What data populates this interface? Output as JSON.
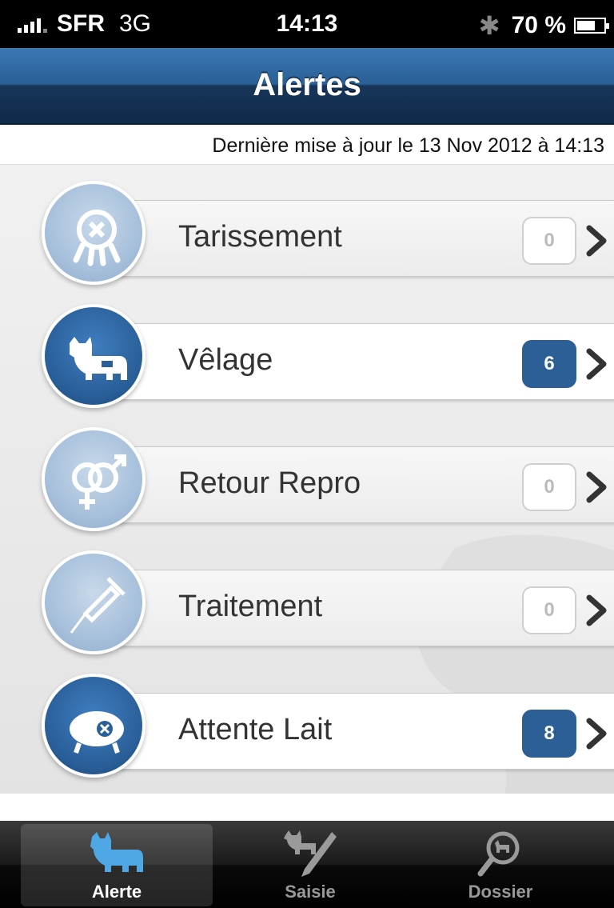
{
  "status_bar": {
    "carrier": "SFR",
    "network": "3G",
    "time": "14:13",
    "bluetooth_icon": "bluetooth-icon",
    "battery_text": "70 %",
    "battery_level": 0.7
  },
  "nav": {
    "title": "Alertes"
  },
  "update": {
    "text": "Dernière mise à jour le 13 Nov 2012 à 14:13"
  },
  "alerts": [
    {
      "label": "Tarissement",
      "count": "0",
      "icon": "udder-icon",
      "active": false
    },
    {
      "label": "Vêlage",
      "count": "6",
      "icon": "cow-icon",
      "active": true
    },
    {
      "label": "Retour Repro",
      "count": "0",
      "icon": "gender-icon",
      "active": false
    },
    {
      "label": "Traitement",
      "count": "0",
      "icon": "syringe-icon",
      "active": false
    },
    {
      "label": "Attente Lait",
      "count": "8",
      "icon": "milk-tank-icon",
      "active": true
    }
  ],
  "tabs": [
    {
      "label": "Alerte",
      "icon": "cow-tab-icon",
      "selected": true
    },
    {
      "label": "Saisie",
      "icon": "cow-pen-icon",
      "selected": false
    },
    {
      "label": "Dossier",
      "icon": "search-cow-icon",
      "selected": false
    }
  ],
  "colors": {
    "accent": "#2b5f96",
    "navbar": "#1e4a78"
  }
}
